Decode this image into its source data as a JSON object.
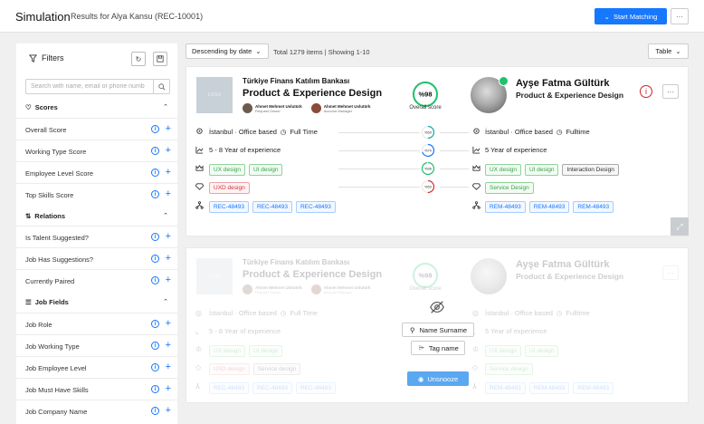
{
  "header": {
    "title": "Simulation",
    "subtitle": "Results for Alya Kansu (REC-10001)",
    "start_matching": "Start Matching",
    "more": "···"
  },
  "sidebar": {
    "title": "Filters",
    "search_placeholder": "Search with name, email or phone numb",
    "sections": [
      {
        "title": "Scores",
        "items": [
          "Overall Score",
          "Working Type Score",
          "Employee Level Score",
          "Top Skills Score"
        ]
      },
      {
        "title": "Relations",
        "items": [
          "Is Talent Suggested?",
          "Job Has Suggestions?",
          "Currently Paired"
        ]
      },
      {
        "title": "Job Fields",
        "items": [
          "Job Role",
          "Job Working Type",
          "Job Employee Level",
          "Job Must Have Skills",
          "Job Company Name"
        ]
      }
    ]
  },
  "toolbar": {
    "sort": "Descending by date",
    "count": "Total 1279 items | Showing 1-10",
    "view": "Table"
  },
  "cards": [
    {
      "org": "Türkiye Finans Katılım Bankası",
      "position": "Product & Experience Design",
      "logo": "LOGO",
      "people": [
        {
          "name": "Ahmet Mehmet Uslutürk",
          "role": "Request Owner"
        },
        {
          "name": "Ahmet Mehmet Uslutürk",
          "role": "Account Manager"
        }
      ],
      "overall_score": "%98",
      "overall_value": 98,
      "overall_label": "Overall score",
      "candidate_name": "Ayşe Fatma Gültürk",
      "candidate_title": "Product & Experience Design",
      "rows": [
        {
          "left": [
            "İstanbul · Office based",
            "Full Time"
          ],
          "score": "%50",
          "value": 50,
          "color": "#1aa7a0",
          "right": [
            "İstanbul · Office based",
            "Fulltime"
          ]
        },
        {
          "left_text": "5 - 8 Year of experience",
          "score": "%70",
          "value": 70,
          "color": "#1677ff",
          "right_text": "5 Year of experience"
        },
        {
          "left_tags": [
            "UX design",
            "UI design"
          ],
          "score": "%96",
          "value": 96,
          "color": "#1fc26b",
          "right_tags": [
            "UX design",
            "UI design",
            "Interaction Design"
          ]
        },
        {
          "left_tags": [
            "UXD design"
          ],
          "score": "%50",
          "value": 50,
          "color": "#d2323c",
          "right_tags": [
            "Service Design"
          ]
        },
        {
          "left_codes": [
            "REC-48493",
            "REC-48493",
            "REC-48493"
          ],
          "right_codes": [
            "REM-48493",
            "REM-48493",
            "REM-48493"
          ]
        }
      ]
    },
    {
      "org": "Türkiye Finans Katılım Bankası",
      "position": "Product & Experience Design",
      "logo": "LOGO",
      "people": [
        {
          "name": "Ahmet Mehmet Uslutürk",
          "role": "Request Owner"
        },
        {
          "name": "Ahmet Mehmet Uslutürk",
          "role": "Account Manager"
        }
      ],
      "overall_score": "%98",
      "overall_label": "Overall score",
      "candidate_name": "Ayşe Fatma Gültürk",
      "candidate_title": "Product & Experience Design",
      "row1_left": [
        "İstanbul · Office based",
        "Full Time"
      ],
      "row1_right": [
        "İstanbul · Office based",
        "Fulltime"
      ],
      "row2_left": "5 - 8 Year of experience",
      "row2_right": "5 Year of experience",
      "row3_left": [
        "UX design",
        "UI design"
      ],
      "row3_right": [
        "UX design",
        "UI design"
      ],
      "row4_left": [
        "UXD design",
        "Service design"
      ],
      "row4_right": [
        "Service design"
      ],
      "row5_left": [
        "REC-48493",
        "REC-48493",
        "REC-48493"
      ],
      "row5_right": [
        "REM-48493",
        "REM-48493",
        "REM-48493"
      ],
      "snooze": {
        "name_pill": "Name Surname",
        "tag_pill": "Tag name",
        "unsnooze": "Unsnooze"
      }
    }
  ],
  "colors": {
    "primary": "#1677ff",
    "success": "#1fc26b",
    "danger": "#d2323c"
  }
}
